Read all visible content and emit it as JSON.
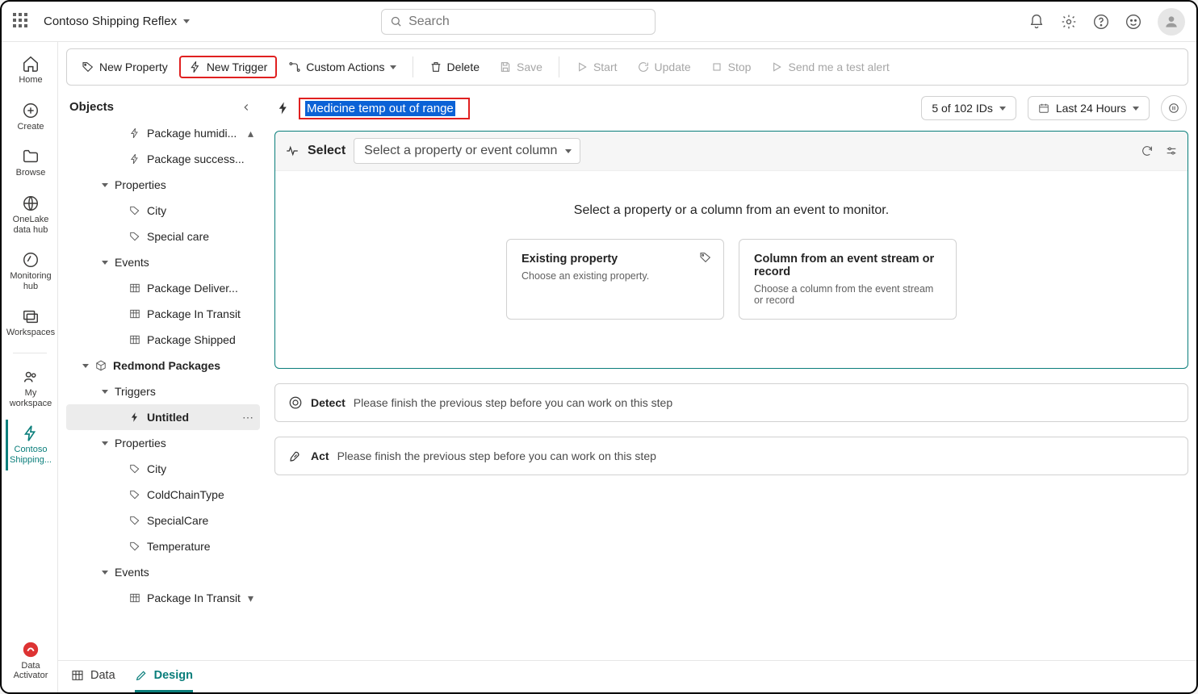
{
  "app_title": "Contoso Shipping Reflex",
  "search_placeholder": "Search",
  "rail": [
    {
      "label": "Home"
    },
    {
      "label": "Create"
    },
    {
      "label": "Browse"
    },
    {
      "label": "OneLake data hub"
    },
    {
      "label": "Monitoring hub"
    },
    {
      "label": "Workspaces"
    },
    {
      "label": "My workspace"
    },
    {
      "label": "Contoso Shipping...",
      "active": true
    }
  ],
  "rail_bottom": {
    "label": "Data Activator"
  },
  "toolbar": {
    "new_property": "New Property",
    "new_trigger": "New Trigger",
    "custom_actions": "Custom Actions",
    "delete": "Delete",
    "save": "Save",
    "start": "Start",
    "update": "Update",
    "stop": "Stop",
    "test_alert": "Send me a test alert"
  },
  "objects_title": "Objects",
  "tree": {
    "pkg_humidity": "Package humidi...",
    "pkg_success": "Package success...",
    "properties_label": "Properties",
    "city": "City",
    "special_care": "Special care",
    "events_label": "Events",
    "evt_delivered": "Package Deliver...",
    "evt_transit": "Package In Transit",
    "evt_shipped": "Package Shipped",
    "redmond": "Redmond Packages",
    "triggers_label": "Triggers",
    "untitled": "Untitled",
    "city2": "City",
    "coldchain": "ColdChainType",
    "specialcare2": "SpecialCare",
    "temperature": "Temperature",
    "evt_transit2": "Package In Transit"
  },
  "trigger_name": "Medicine temp out of range",
  "ids_chip": "5 of 102 IDs",
  "time_chip": "Last 24 Hours",
  "select": {
    "label": "Select",
    "dropdown": "Select a property or event column",
    "hint": "Select a property or a column from an event to monitor.",
    "card1_title": "Existing property",
    "card1_desc": "Choose an existing property.",
    "card2_title": "Column from an event stream or record",
    "card2_desc": "Choose a column from the event stream or record"
  },
  "detect": {
    "title": "Detect",
    "note": "Please finish the previous step before you can work on this step"
  },
  "act": {
    "title": "Act",
    "note": "Please finish the previous step before you can work on this step"
  },
  "footer": {
    "data": "Data",
    "design": "Design"
  }
}
